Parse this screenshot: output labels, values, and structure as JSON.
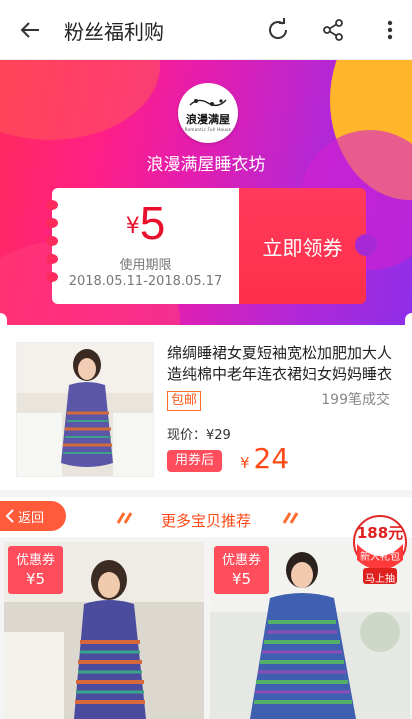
{
  "header": {
    "title": "粉丝福利购",
    "icons": [
      "back-arrow-icon",
      "refresh-icon",
      "share-icon",
      "more-vertical-icon"
    ]
  },
  "shop": {
    "logo_text": "浪漫满屋",
    "logo_sub": "Romantic Full House",
    "name": "浪漫满屋睡衣坊"
  },
  "coupon": {
    "currency": "¥",
    "amount": "5",
    "valid_label": "使用期限",
    "valid_range": "2018.05.11-2018.05.17",
    "claim_label": "立即领券"
  },
  "product": {
    "title": "绵绸睡裙女夏短袖宽松加肥加大人造纯棉中老年连衣裙妇女妈妈睡衣",
    "badge": "包邮",
    "sold": "199笔成交",
    "now_price": "现价：¥29",
    "after_label": "用券后",
    "after_currency": "¥",
    "after_price": "24"
  },
  "more": {
    "back_label": "返回",
    "title": "更多宝贝推荐"
  },
  "promo": {
    "amount": "188元",
    "line1": "新人礼包",
    "cta": "马上抽"
  },
  "cards": [
    {
      "tag": "优惠券",
      "value": "¥5"
    },
    {
      "tag": "优惠券",
      "value": "¥5"
    }
  ],
  "colors": {
    "accent": "#ff4a18",
    "coupon_red": "#ff3a5c",
    "hero_pink": "#ff1f86",
    "hero_purple": "#8f2ee8"
  }
}
